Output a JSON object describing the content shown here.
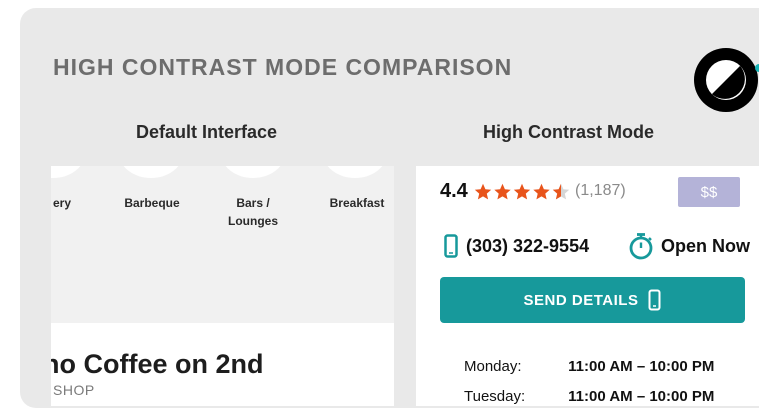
{
  "title": "HIGH CONTRAST MODE COMPARISON",
  "columns": {
    "left": "Default Interface",
    "right": "High Contrast Mode"
  },
  "default_panel": {
    "categories": [
      "ery",
      "Barbeque",
      "Bars /\nLounges",
      "Breakfast"
    ],
    "shop_name": "no Coffee on 2nd",
    "shop_type": "SHOP"
  },
  "high_contrast_panel": {
    "rating": "4.4",
    "rating_stars": 4.5,
    "review_count": "(1,187)",
    "price": "$$",
    "phone": "(303) 322-9554",
    "status": "Open Now",
    "send_button": "SEND DETAILS",
    "hours": [
      {
        "day": "Monday:",
        "time": "11:00 AM – 10:00 PM"
      },
      {
        "day": "Tuesday:",
        "time": "11:00 AM – 10:00 PM"
      }
    ]
  },
  "colors": {
    "accent": "#17999b",
    "stars": "#e8541b",
    "price_badge": "#b4b3d8",
    "background": "#e9e9e9"
  },
  "icons": {
    "mode": "contrast-icon",
    "phone": "mobile-phone-icon",
    "status": "stopwatch-icon",
    "button": "mobile-phone-icon"
  }
}
